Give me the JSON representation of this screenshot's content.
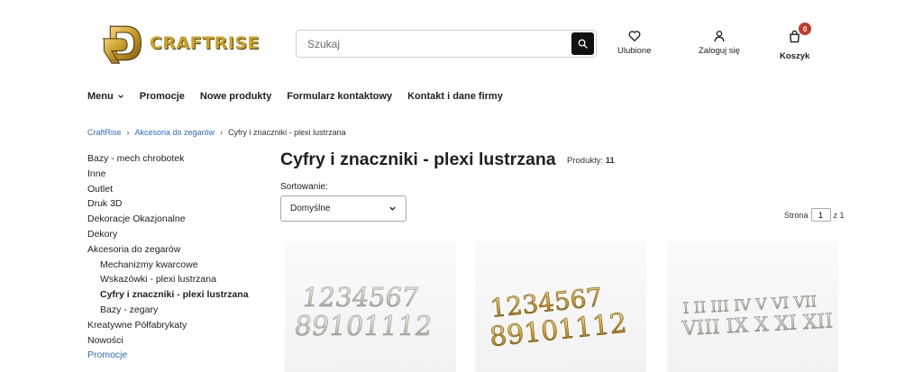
{
  "brand": {
    "name": "CRAFTRISE",
    "logo_icon": "craftrise-logo-icon"
  },
  "search": {
    "placeholder": "Szukaj",
    "icon": "search-icon"
  },
  "header_actions": {
    "favorites": {
      "label": "Ulubione",
      "icon": "heart-icon"
    },
    "login": {
      "label": "Zaloguj się",
      "icon": "user-icon"
    },
    "cart": {
      "label": "Koszyk",
      "icon": "shopping-bag-icon",
      "count": "0"
    }
  },
  "nav": {
    "items": [
      {
        "label": "Menu",
        "icon": "chevron-down-icon"
      },
      {
        "label": "Promocje"
      },
      {
        "label": "Nowe produkty"
      },
      {
        "label": "Formularz kontaktowy"
      },
      {
        "label": "Kontakt i dane firmy"
      }
    ]
  },
  "breadcrumb": {
    "items": [
      "CraftRise",
      "Akcesoria do zegarów",
      "Cyfry i znaczniki - plexi lustrzana"
    ]
  },
  "sidebar": {
    "items": [
      {
        "label": "Bazy - mech chrobotek"
      },
      {
        "label": "Inne"
      },
      {
        "label": "Outlet"
      },
      {
        "label": "Druk 3D"
      },
      {
        "label": "Dekoracje Okazjonalne"
      },
      {
        "label": "Dekory"
      },
      {
        "label": "Akcesoria do zegarów"
      },
      {
        "label": "Mechanizmy kwarcowe"
      },
      {
        "label": "Wskazówki - plexi lustrzana"
      },
      {
        "label": "Cyfry i znaczniki - plexi lustrzana"
      },
      {
        "label": "Bazy - zegary"
      },
      {
        "label": "Kreatywne Półfabrykaty"
      },
      {
        "label": "Nowości"
      },
      {
        "label": "Promocje"
      }
    ]
  },
  "main": {
    "title": "Cyfry i znaczniki - plexi lustrzana",
    "count_label": "Produkty:",
    "count_value": "11",
    "sort_label": "Sortowanie:",
    "sort_value": "Domyślne",
    "pager": {
      "label": "Strona",
      "page": "1",
      "of_label": "z 1"
    }
  },
  "products": [
    {
      "row1": "1234567",
      "row2": "89101112",
      "finish": "silver"
    },
    {
      "row1": "1234567",
      "row2": "89101112",
      "finish": "gold"
    },
    {
      "row1": "I II III IV V VI VII",
      "row2": "VIII IX X XI XII",
      "finish": "silver"
    }
  ],
  "colors": {
    "accent_link": "#2b6fd6",
    "badge": "#c0392b",
    "gold": "#c9a227"
  }
}
